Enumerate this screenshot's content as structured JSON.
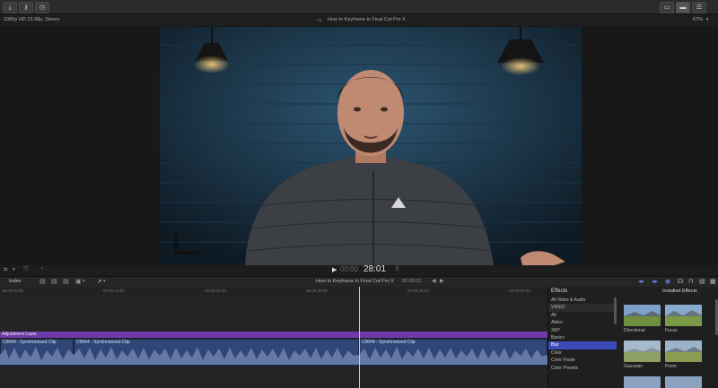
{
  "app": {
    "project_title": "How to Keyframe in Final Cut Pro X",
    "format": "1080p HD 23.98p, Stereo",
    "zoom": "67%"
  },
  "viewer": {
    "current_time": "28:01",
    "time_prefix": "00:00",
    "corner_mark": "L"
  },
  "timeline": {
    "index_label": "Index",
    "project_title": "How to Keyframe in Final Cut Pro X",
    "duration": "01:03:01",
    "ruler_ticks": [
      "00:00:00:00",
      "00:00:10:00",
      "00:00:20:00",
      "00:00:30:00",
      "00:00:40:00",
      "00:00:50:00",
      "00:01:00:00"
    ],
    "adjustment_layer": "Adjustment Layer",
    "clips": [
      "C0044 - Synchronized Clip",
      "C0044 - Synchronized Clip",
      "C0044 - Synchronized Clip"
    ]
  },
  "effects": {
    "header": "Effects",
    "installed_label": "Installed Effects",
    "categories": [
      "All Video & Audio",
      "VIDEO",
      "All",
      "Ableo",
      "360°",
      "Basics",
      "Blur",
      "Color",
      "Color Finale",
      "Color Presets"
    ],
    "selected_category": "Blur",
    "thumbs": [
      {
        "name": "Directional"
      },
      {
        "name": "Focus"
      },
      {
        "name": "Gaussian"
      },
      {
        "name": "Prism"
      }
    ]
  },
  "colors": {
    "accent": "#3b4bb8",
    "adjustment_layer": "#6e3aa8",
    "audio_wave": "#6f83b0",
    "clip_bar": "#2f4676"
  }
}
